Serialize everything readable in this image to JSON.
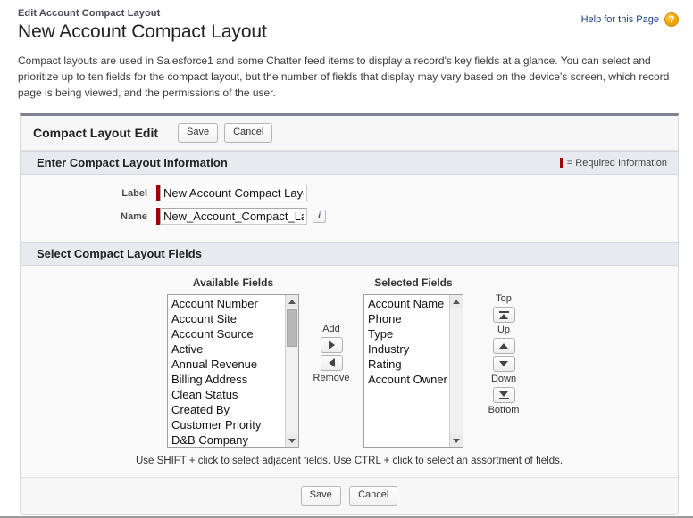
{
  "header": {
    "breadcrumb": "Edit Account Compact Layout",
    "title": "New Account Compact Layout",
    "help_label": "Help for this Page",
    "help_icon_glyph": "?"
  },
  "intro": "Compact layouts are used in Salesforce1 and some Chatter feed items to display a record's key fields at a glance. You can select and prioritize up to ten fields for the compact layout, but the number of fields that display may vary based on the device's screen, which record page is being viewed, and the permissions of the user.",
  "panel": {
    "title": "Compact Layout Edit",
    "save_label": "Save",
    "cancel_label": "Cancel"
  },
  "info_section": {
    "title": "Enter Compact Layout Information",
    "required_legend": "= Required Information",
    "fields": {
      "label_caption": "Label",
      "label_value": "New Account Compact Layo",
      "name_caption": "Name",
      "name_value": "New_Account_Compact_Lay",
      "info_glyph": "i"
    }
  },
  "fields_section": {
    "title": "Select Compact Layout Fields",
    "available_heading": "Available Fields",
    "selected_heading": "Selected Fields",
    "available_fields": [
      "Account Number",
      "Account Site",
      "Account Source",
      "Active",
      "Annual Revenue",
      "Billing Address",
      "Clean Status",
      "Created By",
      "Customer Priority",
      "D&B Company"
    ],
    "selected_fields": [
      "Account Name",
      "Phone",
      "Type",
      "Industry",
      "Rating",
      "Account Owner"
    ],
    "add_label": "Add",
    "remove_label": "Remove",
    "top_label": "Top",
    "up_label": "Up",
    "down_label": "Down",
    "bottom_label": "Bottom",
    "hint": "Use SHIFT + click to select adjacent fields. Use CTRL + click to select an assortment of fields."
  },
  "footer": {
    "save_label": "Save",
    "cancel_label": "Cancel"
  },
  "colors": {
    "required_red": "#a30000",
    "link_blue": "#1a3d8f",
    "help_orange": "#f0a500",
    "section_bar": "#e8eaf0"
  }
}
